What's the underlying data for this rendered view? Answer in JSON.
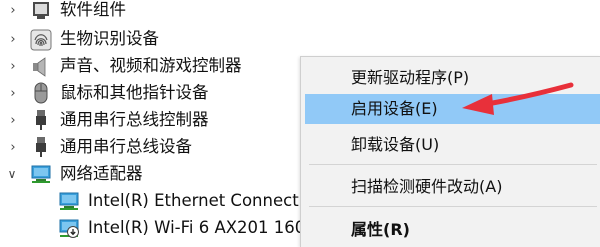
{
  "tree": {
    "items": [
      {
        "label": "软件组件",
        "icon": "software-component-icon",
        "expanded": false
      },
      {
        "label": "生物识别设备",
        "icon": "fingerprint-icon",
        "expanded": false
      },
      {
        "label": "声音、视频和游戏控制器",
        "icon": "speaker-icon",
        "expanded": false
      },
      {
        "label": "鼠标和其他指针设备",
        "icon": "mouse-icon",
        "expanded": false
      },
      {
        "label": "通用串行总线控制器",
        "icon": "usb-icon",
        "expanded": false
      },
      {
        "label": "通用串行总线设备",
        "icon": "usb-icon",
        "expanded": false
      },
      {
        "label": "网络适配器",
        "icon": "network-adapter-icon",
        "expanded": true
      }
    ],
    "children": [
      {
        "label": "Intel(R) Ethernet Connecti",
        "icon": "network-adapter-icon"
      },
      {
        "label": "Intel(R) Wi-Fi 6 AX201 160",
        "icon": "network-adapter-disabled-icon"
      }
    ]
  },
  "context_menu": {
    "items": [
      {
        "label": "更新驱动程序(P)",
        "highlighted": false,
        "bold": false
      },
      {
        "label": "启用设备(E)",
        "highlighted": true,
        "bold": false
      },
      {
        "label": "卸载设备(U)",
        "highlighted": false,
        "bold": false
      },
      {
        "label": "扫描检测硬件改动(A)",
        "highlighted": false,
        "bold": false
      },
      {
        "label": "属性(R)",
        "highlighted": false,
        "bold": true
      }
    ]
  },
  "colors": {
    "highlight": "#91c9f7",
    "arrow": "#e8303a",
    "menu_bg": "#f2f2f2"
  }
}
